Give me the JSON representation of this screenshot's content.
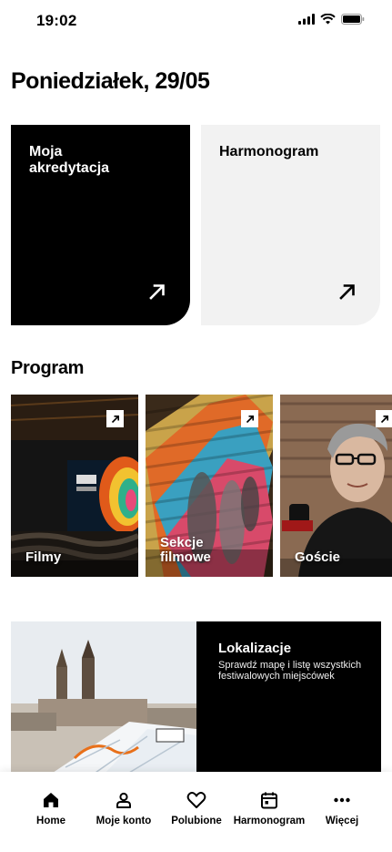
{
  "status_bar": {
    "time": "19:02"
  },
  "page_title": "Poniedziałek, 29/05",
  "tiles": {
    "accreditation": "Moja akredytacja",
    "schedule": "Harmonogram"
  },
  "program": {
    "title": "Program",
    "cards": [
      {
        "label": "Filmy"
      },
      {
        "label": "Sekcje filmowe"
      },
      {
        "label": "Goście"
      }
    ]
  },
  "location": {
    "title": "Lokalizacje",
    "description": "Sprawdź mapę i listę wszystkich festiwalowych miejscówek"
  },
  "bottom_nav": [
    {
      "label": "Home",
      "icon": "home-icon"
    },
    {
      "label": "Moje konto",
      "icon": "user-icon"
    },
    {
      "label": "Polubione",
      "icon": "heart-icon"
    },
    {
      "label": "Harmonogram",
      "icon": "calendar-icon"
    },
    {
      "label": "Więcej",
      "icon": "more-icon"
    }
  ]
}
